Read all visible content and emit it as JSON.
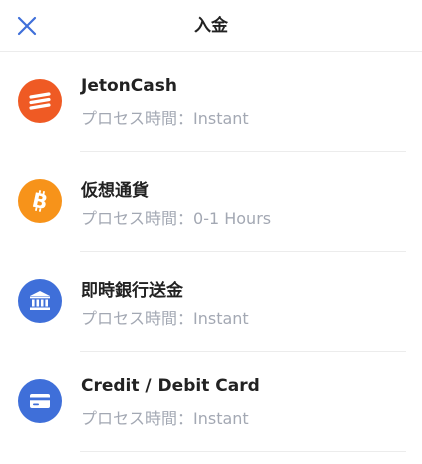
{
  "header": {
    "title": "入金",
    "close_icon": "close-icon",
    "accent_color": "#3f6fd9"
  },
  "methods": [
    {
      "name": "JetonCash",
      "processing_label": "プロセス時間：",
      "processing_value": "Instant",
      "icon": "jetoncash-logo-icon",
      "icon_color": "#ef5a24"
    },
    {
      "name": "仮想通貨",
      "processing_label": "プロセス時間：",
      "processing_value": "0-1 Hours",
      "icon": "bitcoin-icon",
      "icon_color": "#f7931a"
    },
    {
      "name": "即時銀行送金",
      "processing_label": "プロセス時間：",
      "processing_value": "Instant",
      "icon": "bank-icon",
      "icon_color": "#3f6fd9"
    },
    {
      "name": "Credit / Debit Card",
      "processing_label": "プロセス時間：",
      "processing_value": "Instant",
      "icon": "credit-card-icon",
      "icon_color": "#3f6fd9"
    }
  ]
}
